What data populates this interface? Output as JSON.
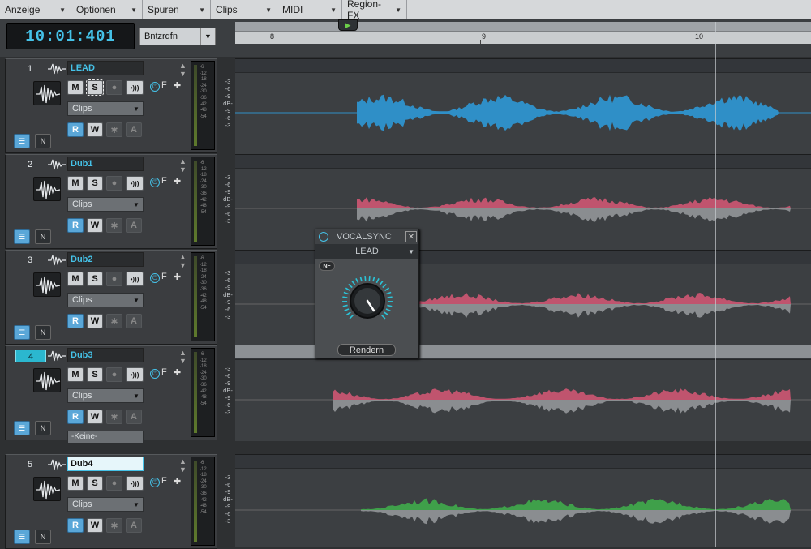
{
  "menu": [
    "Anzeige",
    "Optionen",
    "Spuren",
    "Clips",
    "MIDI",
    "Region-FX"
  ],
  "clock": "10:01:401",
  "preset": "Bntzrdfn",
  "ruler": {
    "marks": [
      "8",
      "9",
      "10"
    ]
  },
  "tracks": [
    {
      "num": "1",
      "name": "LEAD",
      "clips": "Clips",
      "F": "F",
      "wave": "blue"
    },
    {
      "num": "2",
      "name": "Dub1",
      "clips": "Clips",
      "F": "F",
      "wave": "pink"
    },
    {
      "num": "3",
      "name": "Dub2",
      "clips": "Clips",
      "F": "F",
      "wave": "pink"
    },
    {
      "num": "4",
      "name": "Dub3",
      "clips": "Clips",
      "F": "F",
      "wave": "pink",
      "extra": "-Keine-"
    },
    {
      "num": "5",
      "name": "Dub4",
      "clips": "Clips",
      "F": "F",
      "wave": "green"
    }
  ],
  "buttons": {
    "mute": "M",
    "solo": "S",
    "read": "R",
    "write": "W",
    "asterisk": "✱",
    "auto": "A"
  },
  "db_scale": [
    "-3",
    "-6",
    "-9",
    "dB-",
    "-9",
    "-6",
    "-3"
  ],
  "meter_scale": [
    "-6",
    "-12",
    "-18",
    "-24",
    "-30",
    "-36",
    "-42",
    "-48",
    "-54"
  ],
  "vocalsync": {
    "title": "VOCALSYNC",
    "source": "LEAD",
    "nf": "NF",
    "render": "Rendern"
  },
  "colors": {
    "accent": "#45c2e8",
    "lead_wave": "#2f8fc7",
    "dub_wave": "#c0546e",
    "dub_lower": "#8a8d90",
    "dub4_wave": "#3fa04a"
  }
}
